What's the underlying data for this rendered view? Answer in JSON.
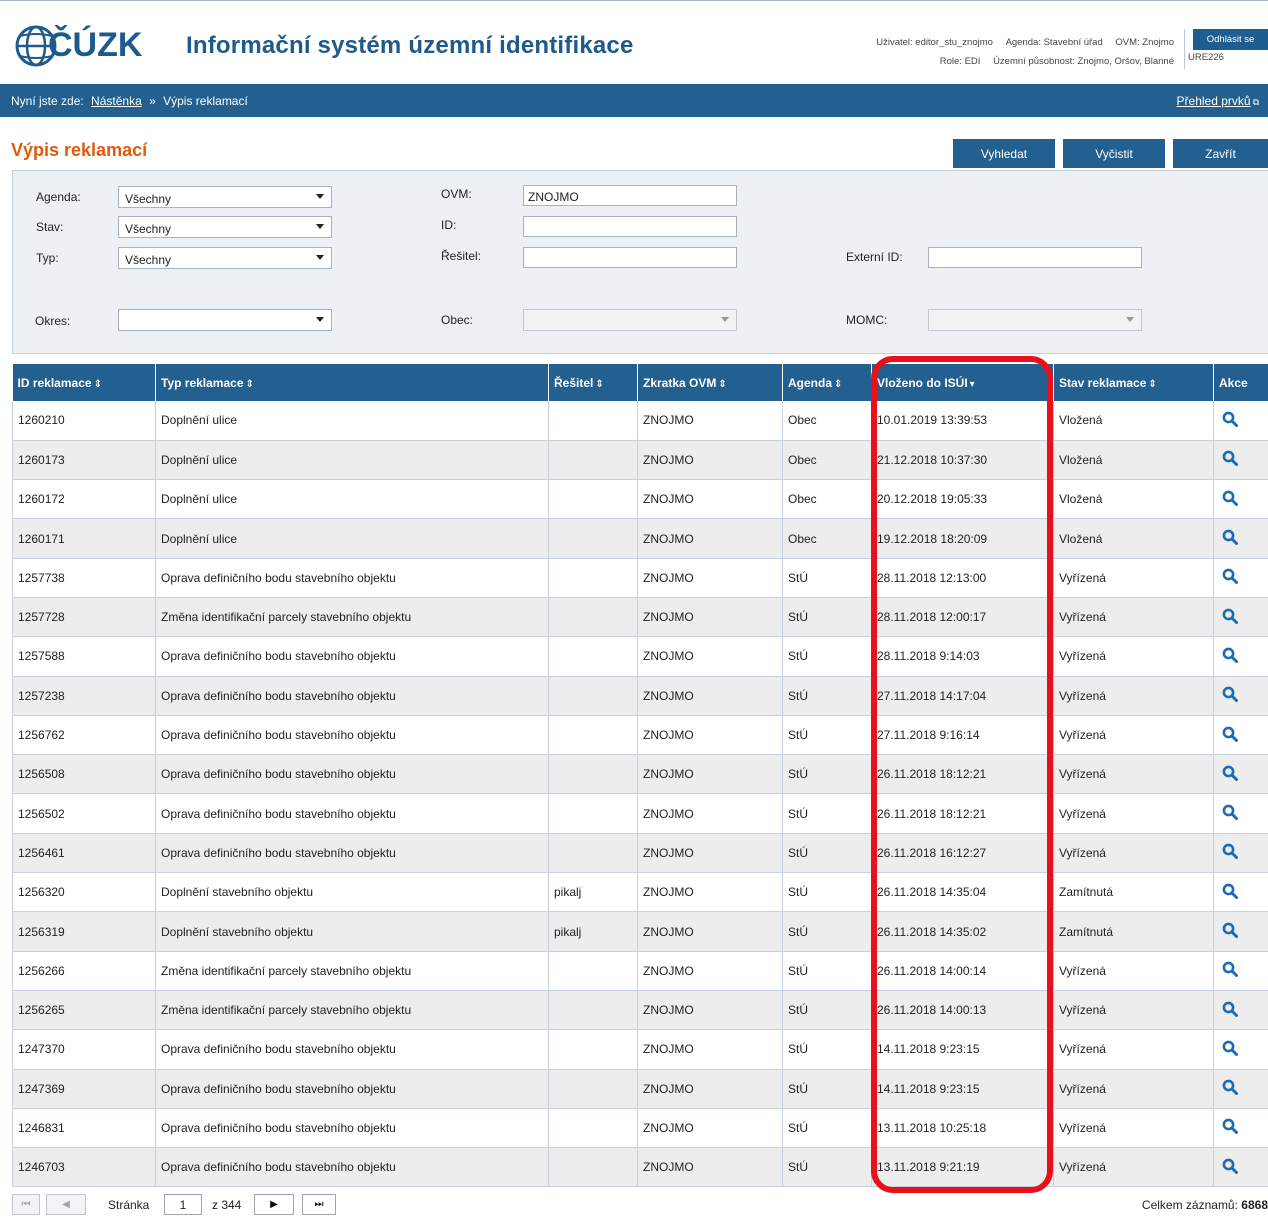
{
  "header": {
    "logo_text": "ČÚZK",
    "app_title": "Informační systém územní identifikace",
    "user_label": "Uživatel: editor_stu_znojmo",
    "agenda_label": "Agenda: Stavební úřad",
    "ovm_label": "OVM: Znojmo",
    "role_label": "Role: EDI",
    "scope_label": "Územní působnost: Znojmo, Oršov, Blanné",
    "code": "URE226",
    "logout_label": "Odhlásit se"
  },
  "breadcrumb": {
    "prefix": "Nyní jste zde:",
    "home": "Nástěnka",
    "separator": "»",
    "current": "Výpis reklamací",
    "overview_link": "Přehled prvků"
  },
  "page": {
    "title": "Výpis reklamací",
    "search_button": "Vyhledat",
    "clear_button": "Vyčistit",
    "close_button": "Zavřít"
  },
  "filter": {
    "agenda_label": "Agenda:",
    "agenda_value": "Všechny",
    "stav_label": "Stav:",
    "stav_value": "Všechny",
    "typ_label": "Typ:",
    "typ_value": "Všechny",
    "okres_label": "Okres:",
    "okres_value": "",
    "ovm_label": "OVM:",
    "ovm_value": "ZNOJMO",
    "id_label": "ID:",
    "id_value": "",
    "resitel_label": "Řešitel:",
    "resitel_value": "",
    "obec_label": "Obec:",
    "externi_label": "Externí ID:",
    "externi_value": "",
    "momc_label": "MOMC:"
  },
  "table": {
    "columns": [
      "ID reklamace",
      "Typ reklamace",
      "Řešitel",
      "Zkratka OVM",
      "Agenda",
      "Vloženo do ISÚI",
      "Stav reklamace",
      "Akce"
    ],
    "sort_indicator": "⇕",
    "sort_active": "▾",
    "rows": [
      [
        "1260210",
        "Doplnění ulice",
        "",
        "ZNOJMO",
        "Obec",
        "10.01.2019 13:39:53",
        "Vložená"
      ],
      [
        "1260173",
        "Doplnění ulice",
        "",
        "ZNOJMO",
        "Obec",
        "21.12.2018 10:37:30",
        "Vložená"
      ],
      [
        "1260172",
        "Doplnění ulice",
        "",
        "ZNOJMO",
        "Obec",
        "20.12.2018 19:05:33",
        "Vložená"
      ],
      [
        "1260171",
        "Doplnění ulice",
        "",
        "ZNOJMO",
        "Obec",
        "19.12.2018 18:20:09",
        "Vložená"
      ],
      [
        "1257738",
        "Oprava definičního bodu stavebního objektu",
        "",
        "ZNOJMO",
        "StÚ",
        "28.11.2018 12:13:00",
        "Vyřízená"
      ],
      [
        "1257728",
        "Změna identifikační parcely stavebního objektu",
        "",
        "ZNOJMO",
        "StÚ",
        "28.11.2018 12:00:17",
        "Vyřízená"
      ],
      [
        "1257588",
        "Oprava definičního bodu stavebního objektu",
        "",
        "ZNOJMO",
        "StÚ",
        "28.11.2018 9:14:03",
        "Vyřízená"
      ],
      [
        "1257238",
        "Oprava definičního bodu stavebního objektu",
        "",
        "ZNOJMO",
        "StÚ",
        "27.11.2018 14:17:04",
        "Vyřízená"
      ],
      [
        "1256762",
        "Oprava definičního bodu stavebního objektu",
        "",
        "ZNOJMO",
        "StÚ",
        "27.11.2018 9:16:14",
        "Vyřízená"
      ],
      [
        "1256508",
        "Oprava definičního bodu stavebního objektu",
        "",
        "ZNOJMO",
        "StÚ",
        "26.11.2018 18:12:21",
        "Vyřízená"
      ],
      [
        "1256502",
        "Oprava definičního bodu stavebního objektu",
        "",
        "ZNOJMO",
        "StÚ",
        "26.11.2018 18:12:21",
        "Vyřízená"
      ],
      [
        "1256461",
        "Oprava definičního bodu stavebního objektu",
        "",
        "ZNOJMO",
        "StÚ",
        "26.11.2018 16:12:27",
        "Vyřízená"
      ],
      [
        "1256320",
        "Doplnění stavebního objektu",
        "pikalj",
        "ZNOJMO",
        "StÚ",
        "26.11.2018 14:35:04",
        "Zamítnutá"
      ],
      [
        "1256319",
        "Doplnění stavebního objektu",
        "pikalj",
        "ZNOJMO",
        "StÚ",
        "26.11.2018 14:35:02",
        "Zamítnutá"
      ],
      [
        "1256266",
        "Změna identifikační parcely stavebního objektu",
        "",
        "ZNOJMO",
        "StÚ",
        "26.11.2018 14:00:14",
        "Vyřízená"
      ],
      [
        "1256265",
        "Změna identifikační parcely stavebního objektu",
        "",
        "ZNOJMO",
        "StÚ",
        "26.11.2018 14:00:13",
        "Vyřízená"
      ],
      [
        "1247370",
        "Oprava definičního bodu stavebního objektu",
        "",
        "ZNOJMO",
        "StÚ",
        "14.11.2018 9:23:15",
        "Vyřízená"
      ],
      [
        "1247369",
        "Oprava definičního bodu stavebního objektu",
        "",
        "ZNOJMO",
        "StÚ",
        "14.11.2018 9:23:15",
        "Vyřízená"
      ],
      [
        "1246831",
        "Oprava definičního bodu stavebního objektu",
        "",
        "ZNOJMO",
        "StÚ",
        "13.11.2018 10:25:18",
        "Vyřízená"
      ],
      [
        "1246703",
        "Oprava definičního bodu stavebního objektu",
        "",
        "ZNOJMO",
        "StÚ",
        "13.11.2018 9:21:19",
        "Vyřízená"
      ]
    ]
  },
  "pager": {
    "page_label": "Stránka",
    "current_page": "1",
    "of_label": "z 344",
    "total_label": "Celkem záznamů:",
    "total_value": "6868"
  },
  "colors": {
    "brand_blue": "#235f8f",
    "title_orange": "#e05a0a",
    "highlight_red": "#e8101b",
    "search_icon": "#1b6bb5"
  },
  "icons": [
    "cuzk-logo-icon",
    "search-icon",
    "external-link-icon",
    "dropdown-arrow-icon",
    "first-page-icon",
    "prev-page-icon",
    "next-page-icon",
    "last-page-icon"
  ]
}
